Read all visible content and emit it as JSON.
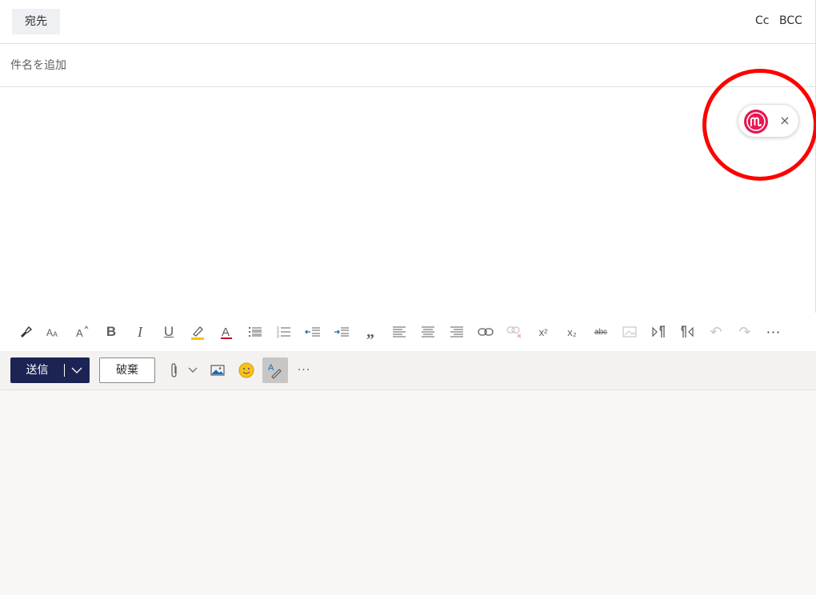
{
  "header": {
    "to_label": "宛先",
    "cc_label": "Cc",
    "bcc_label": "BCC"
  },
  "subject": {
    "placeholder": "件名を追加",
    "value": ""
  },
  "addin": {
    "logo_icon": "addin-logo-icon",
    "close_glyph": "×",
    "brand_color": "#e8174f"
  },
  "format_toolbar": {
    "buttons": [
      {
        "name": "format-painter",
        "glyph": ""
      },
      {
        "name": "font-size",
        "glyph": ""
      },
      {
        "name": "grow-font",
        "glyph": ""
      },
      {
        "name": "bold",
        "glyph": "B"
      },
      {
        "name": "italic",
        "glyph": "I"
      },
      {
        "name": "underline",
        "glyph": "U"
      },
      {
        "name": "highlight",
        "glyph": ""
      },
      {
        "name": "font-color",
        "glyph": "A"
      },
      {
        "name": "bullets",
        "glyph": ""
      },
      {
        "name": "numbering",
        "glyph": ""
      },
      {
        "name": "decrease-indent",
        "glyph": ""
      },
      {
        "name": "increase-indent",
        "glyph": ""
      },
      {
        "name": "quote",
        "glyph": "„"
      },
      {
        "name": "align-left",
        "glyph": ""
      },
      {
        "name": "align-center",
        "glyph": ""
      },
      {
        "name": "align-right",
        "glyph": ""
      },
      {
        "name": "insert-link",
        "glyph": ""
      },
      {
        "name": "remove-link",
        "glyph": ""
      },
      {
        "name": "superscript",
        "glyph": "x²"
      },
      {
        "name": "subscript",
        "glyph": "x₂"
      },
      {
        "name": "strikethrough",
        "glyph": "abc"
      },
      {
        "name": "insert-picture-inline",
        "glyph": ""
      },
      {
        "name": "ltr",
        "glyph": ""
      },
      {
        "name": "rtl",
        "glyph": ""
      },
      {
        "name": "undo",
        "glyph": "↶"
      },
      {
        "name": "redo",
        "glyph": "↷"
      },
      {
        "name": "more-format",
        "glyph": "···"
      }
    ]
  },
  "actions": {
    "send_label": "送信",
    "discard_label": "破棄",
    "more_glyph": "···"
  },
  "colors": {
    "send_bg": "#1b2453",
    "addin_ring": "#ff0000",
    "highlight_yellow": "#f5c400"
  }
}
